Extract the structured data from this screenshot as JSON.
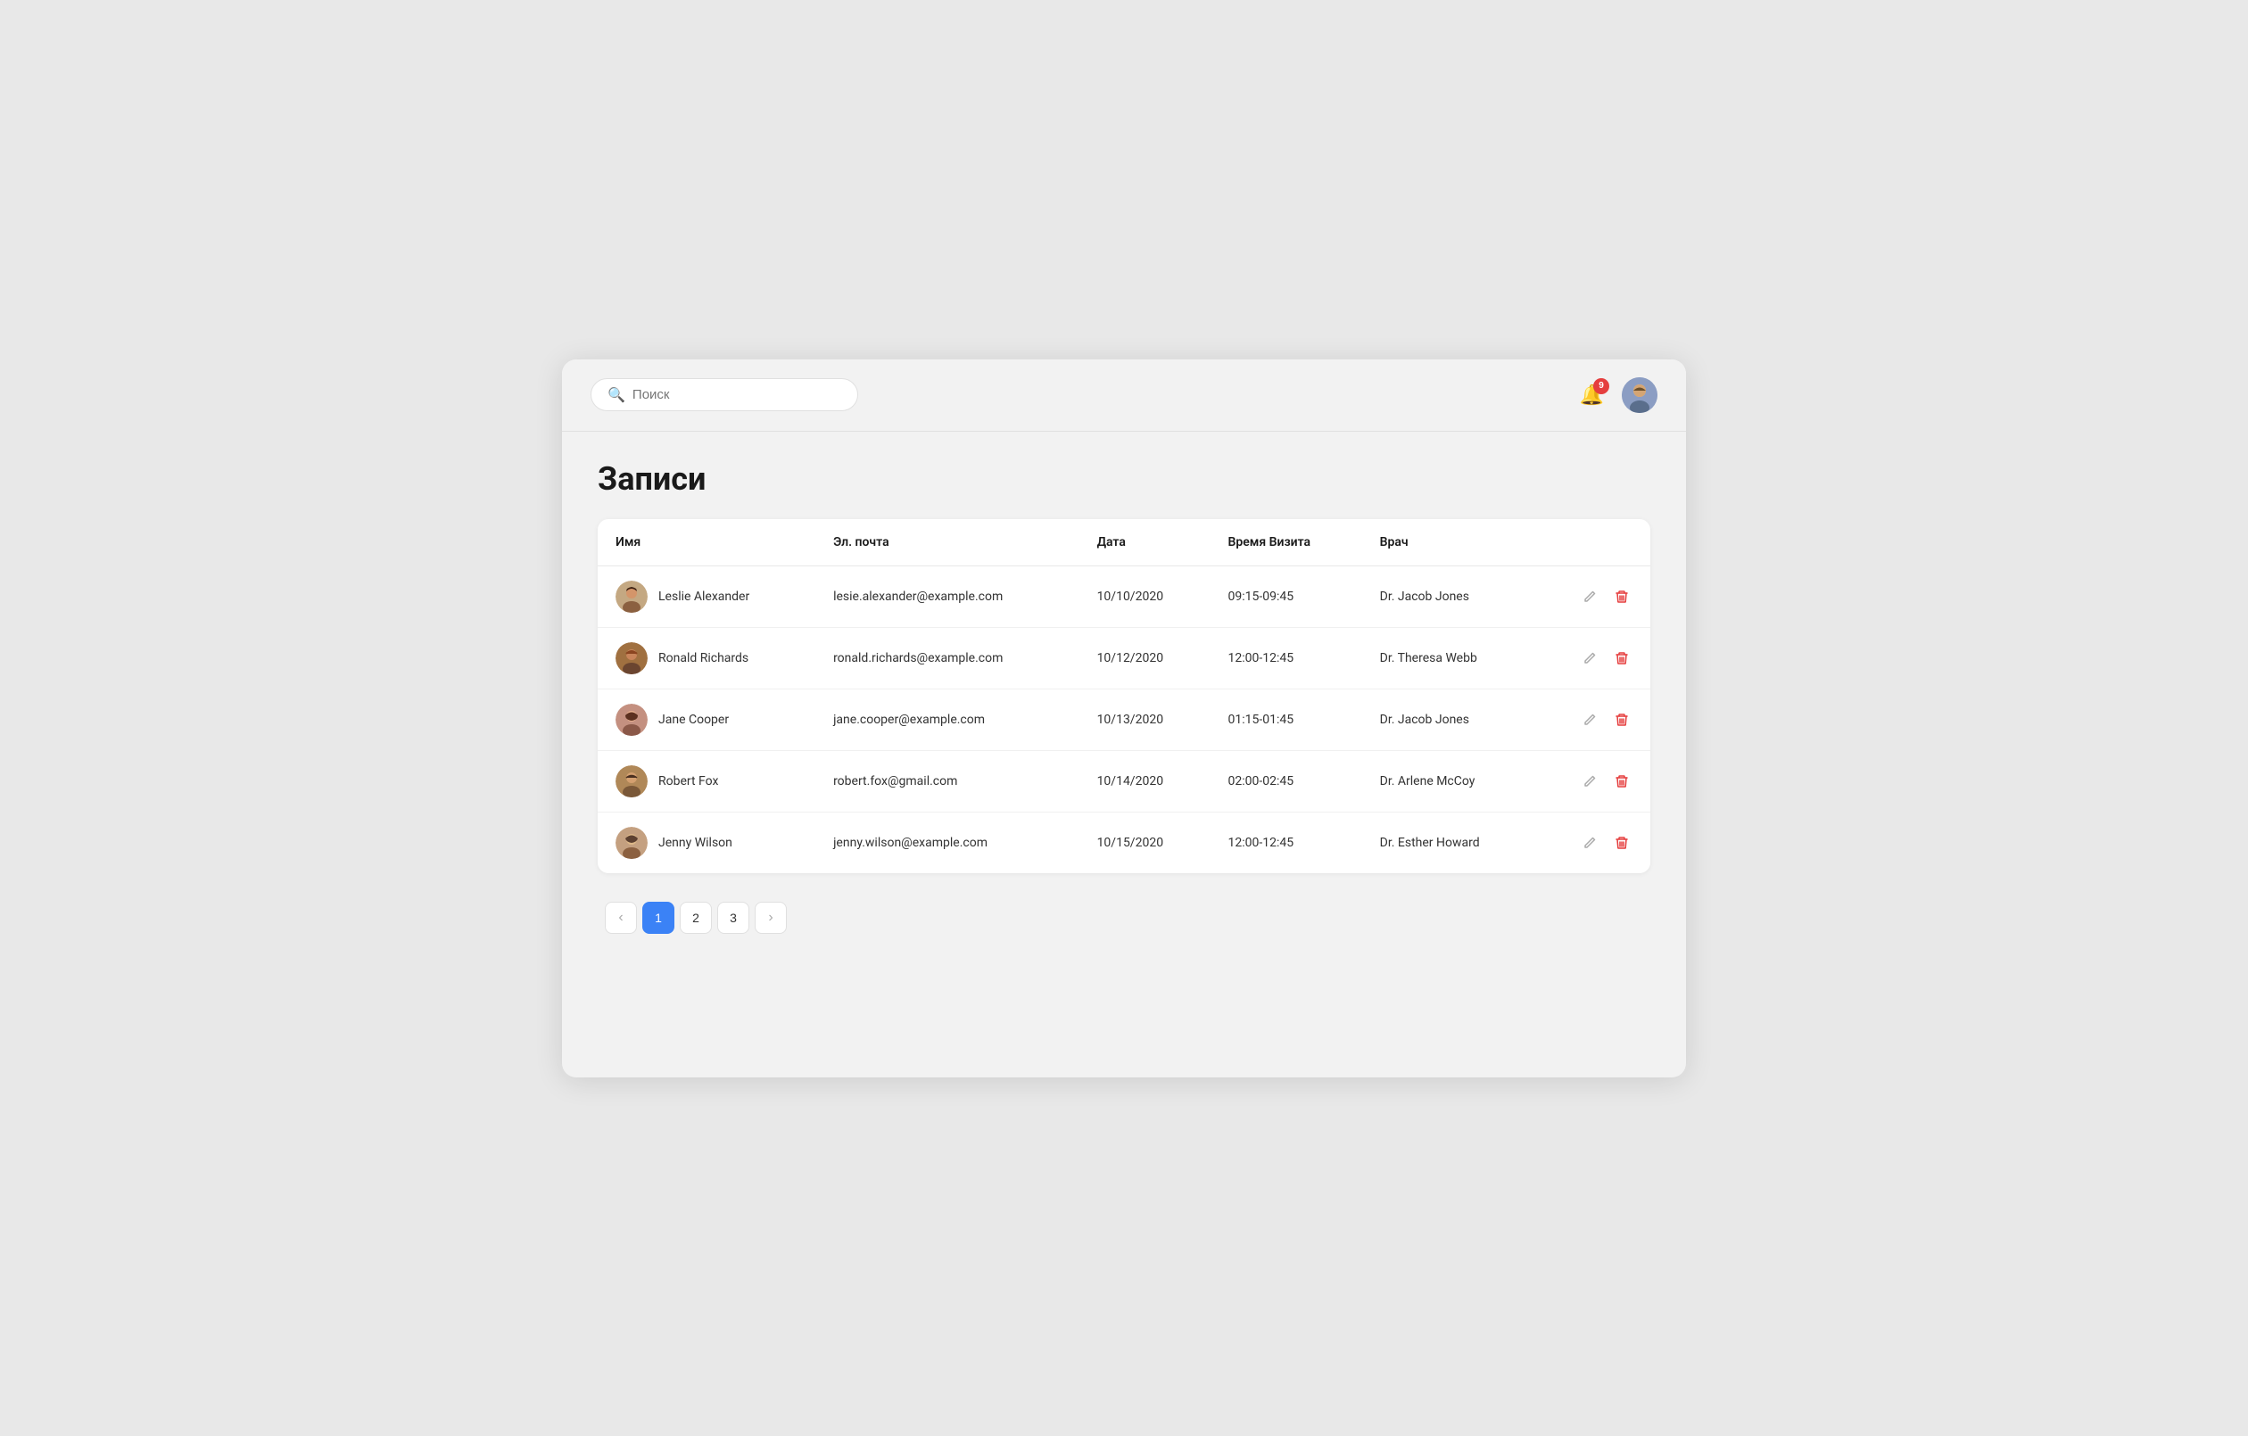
{
  "header": {
    "search_placeholder": "Поиск",
    "notification_count": "9"
  },
  "page": {
    "title": "Записи"
  },
  "table": {
    "columns": [
      "Имя",
      "Эл. почта",
      "Дата",
      "Время Визита",
      "Врач"
    ],
    "rows": [
      {
        "id": 1,
        "name": "Leslie Alexander",
        "email": "lesie.alexander@example.com",
        "date": "10/10/2020",
        "time": "09:15-09:45",
        "doctor": "Dr. Jacob Jones",
        "avatar_color": "#c4a882"
      },
      {
        "id": 2,
        "name": "Ronald Richards",
        "email": "ronald.richards@example.com",
        "date": "10/12/2020",
        "time": "12:00-12:45",
        "doctor": "Dr. Theresa Webb",
        "avatar_color": "#a07040"
      },
      {
        "id": 3,
        "name": "Jane Cooper",
        "email": "jane.cooper@example.com",
        "date": "10/13/2020",
        "time": "01:15-01:45",
        "doctor": "Dr. Jacob Jones",
        "avatar_color": "#c49080"
      },
      {
        "id": 4,
        "name": "Robert Fox",
        "email": "robert.fox@gmail.com",
        "date": "10/14/2020",
        "time": "02:00-02:45",
        "doctor": "Dr. Arlene McCoy",
        "avatar_color": "#b08858"
      },
      {
        "id": 5,
        "name": "Jenny Wilson",
        "email": "jenny.wilson@example.com",
        "date": "10/15/2020",
        "time": "12:00-12:45",
        "doctor": "Dr. Esther Howard",
        "avatar_color": "#c4a080"
      }
    ]
  },
  "pagination": {
    "prev_label": "‹",
    "next_label": "›",
    "pages": [
      "1",
      "2",
      "3"
    ],
    "active_page": "1"
  }
}
